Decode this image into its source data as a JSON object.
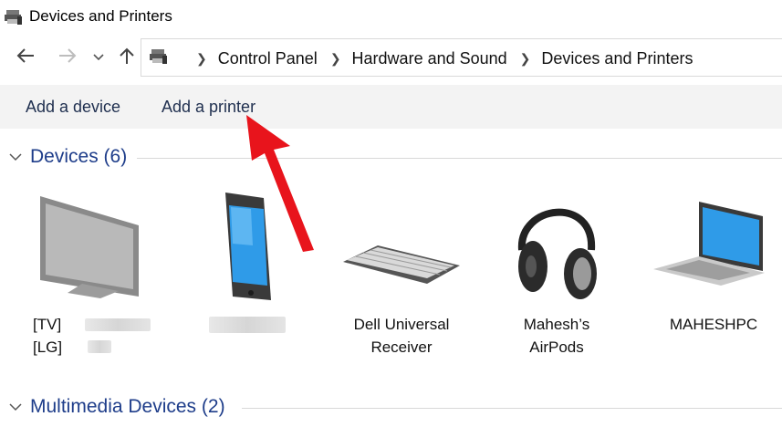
{
  "window": {
    "title": "Devices and Printers"
  },
  "nav": {
    "back_icon": "arrow-left-icon",
    "forward_icon": "arrow-right-icon",
    "recent_icon": "chevron-down-icon",
    "up_icon": "arrow-up-icon"
  },
  "address": {
    "crumbs": [
      "Control Panel",
      "Hardware and Sound",
      "Devices and Printers"
    ]
  },
  "commands": {
    "add_device": "Add a device",
    "add_printer": "Add a printer"
  },
  "groups": {
    "devices": {
      "label": "Devices (6)",
      "items": [
        {
          "label": "[TV][LG]",
          "icon": "tv-icon"
        },
        {
          "label": "",
          "icon": "phone-icon"
        },
        {
          "label": "Dell Universal Receiver",
          "line1": "Dell Universal",
          "line2": "Receiver",
          "icon": "keyboard-icon"
        },
        {
          "label": "Mahesh’s AirPods",
          "line1": "Mahesh’s",
          "line2": "AirPods",
          "icon": "headphones-icon"
        },
        {
          "label": "MAHESHPC",
          "icon": "laptop-icon"
        }
      ]
    },
    "multimedia": {
      "label": "Multimedia Devices (2)"
    }
  },
  "annotation": {
    "arrow_color": "#e8141c"
  }
}
